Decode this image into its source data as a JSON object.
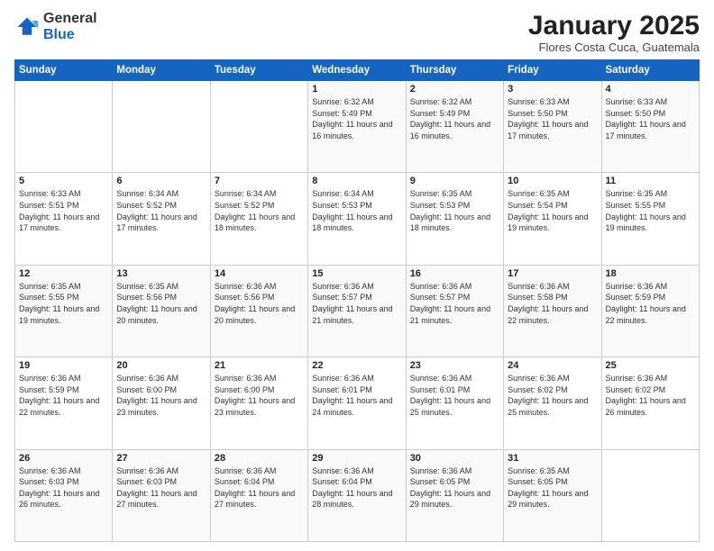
{
  "header": {
    "logo_general": "General",
    "logo_blue": "Blue",
    "month_title": "January 2025",
    "location": "Flores Costa Cuca, Guatemala"
  },
  "days_of_week": [
    "Sunday",
    "Monday",
    "Tuesday",
    "Wednesday",
    "Thursday",
    "Friday",
    "Saturday"
  ],
  "weeks": [
    [
      {
        "day": "",
        "info": ""
      },
      {
        "day": "",
        "info": ""
      },
      {
        "day": "",
        "info": ""
      },
      {
        "day": "1",
        "info": "Sunrise: 6:32 AM\nSunset: 5:49 PM\nDaylight: 11 hours\nand 16 minutes."
      },
      {
        "day": "2",
        "info": "Sunrise: 6:32 AM\nSunset: 5:49 PM\nDaylight: 11 hours\nand 16 minutes."
      },
      {
        "day": "3",
        "info": "Sunrise: 6:33 AM\nSunset: 5:50 PM\nDaylight: 11 hours\nand 17 minutes."
      },
      {
        "day": "4",
        "info": "Sunrise: 6:33 AM\nSunset: 5:50 PM\nDaylight: 11 hours\nand 17 minutes."
      }
    ],
    [
      {
        "day": "5",
        "info": "Sunrise: 6:33 AM\nSunset: 5:51 PM\nDaylight: 11 hours\nand 17 minutes."
      },
      {
        "day": "6",
        "info": "Sunrise: 6:34 AM\nSunset: 5:52 PM\nDaylight: 11 hours\nand 17 minutes."
      },
      {
        "day": "7",
        "info": "Sunrise: 6:34 AM\nSunset: 5:52 PM\nDaylight: 11 hours\nand 18 minutes."
      },
      {
        "day": "8",
        "info": "Sunrise: 6:34 AM\nSunset: 5:53 PM\nDaylight: 11 hours\nand 18 minutes."
      },
      {
        "day": "9",
        "info": "Sunrise: 6:35 AM\nSunset: 5:53 PM\nDaylight: 11 hours\nand 18 minutes."
      },
      {
        "day": "10",
        "info": "Sunrise: 6:35 AM\nSunset: 5:54 PM\nDaylight: 11 hours\nand 19 minutes."
      },
      {
        "day": "11",
        "info": "Sunrise: 6:35 AM\nSunset: 5:55 PM\nDaylight: 11 hours\nand 19 minutes."
      }
    ],
    [
      {
        "day": "12",
        "info": "Sunrise: 6:35 AM\nSunset: 5:55 PM\nDaylight: 11 hours\nand 19 minutes."
      },
      {
        "day": "13",
        "info": "Sunrise: 6:35 AM\nSunset: 5:56 PM\nDaylight: 11 hours\nand 20 minutes."
      },
      {
        "day": "14",
        "info": "Sunrise: 6:36 AM\nSunset: 5:56 PM\nDaylight: 11 hours\nand 20 minutes."
      },
      {
        "day": "15",
        "info": "Sunrise: 6:36 AM\nSunset: 5:57 PM\nDaylight: 11 hours\nand 21 minutes."
      },
      {
        "day": "16",
        "info": "Sunrise: 6:36 AM\nSunset: 5:57 PM\nDaylight: 11 hours\nand 21 minutes."
      },
      {
        "day": "17",
        "info": "Sunrise: 6:36 AM\nSunset: 5:58 PM\nDaylight: 11 hours\nand 22 minutes."
      },
      {
        "day": "18",
        "info": "Sunrise: 6:36 AM\nSunset: 5:59 PM\nDaylight: 11 hours\nand 22 minutes."
      }
    ],
    [
      {
        "day": "19",
        "info": "Sunrise: 6:36 AM\nSunset: 5:59 PM\nDaylight: 11 hours\nand 22 minutes."
      },
      {
        "day": "20",
        "info": "Sunrise: 6:36 AM\nSunset: 6:00 PM\nDaylight: 11 hours\nand 23 minutes."
      },
      {
        "day": "21",
        "info": "Sunrise: 6:36 AM\nSunset: 6:00 PM\nDaylight: 11 hours\nand 23 minutes."
      },
      {
        "day": "22",
        "info": "Sunrise: 6:36 AM\nSunset: 6:01 PM\nDaylight: 11 hours\nand 24 minutes."
      },
      {
        "day": "23",
        "info": "Sunrise: 6:36 AM\nSunset: 6:01 PM\nDaylight: 11 hours\nand 25 minutes."
      },
      {
        "day": "24",
        "info": "Sunrise: 6:36 AM\nSunset: 6:02 PM\nDaylight: 11 hours\nand 25 minutes."
      },
      {
        "day": "25",
        "info": "Sunrise: 6:36 AM\nSunset: 6:02 PM\nDaylight: 11 hours\nand 26 minutes."
      }
    ],
    [
      {
        "day": "26",
        "info": "Sunrise: 6:36 AM\nSunset: 6:03 PM\nDaylight: 11 hours\nand 26 minutes."
      },
      {
        "day": "27",
        "info": "Sunrise: 6:36 AM\nSunset: 6:03 PM\nDaylight: 11 hours\nand 27 minutes."
      },
      {
        "day": "28",
        "info": "Sunrise: 6:36 AM\nSunset: 6:04 PM\nDaylight: 11 hours\nand 27 minutes."
      },
      {
        "day": "29",
        "info": "Sunrise: 6:36 AM\nSunset: 6:04 PM\nDaylight: 11 hours\nand 28 minutes."
      },
      {
        "day": "30",
        "info": "Sunrise: 6:36 AM\nSunset: 6:05 PM\nDaylight: 11 hours\nand 29 minutes."
      },
      {
        "day": "31",
        "info": "Sunrise: 6:35 AM\nSunset: 6:05 PM\nDaylight: 11 hours\nand 29 minutes."
      },
      {
        "day": "",
        "info": ""
      }
    ]
  ]
}
